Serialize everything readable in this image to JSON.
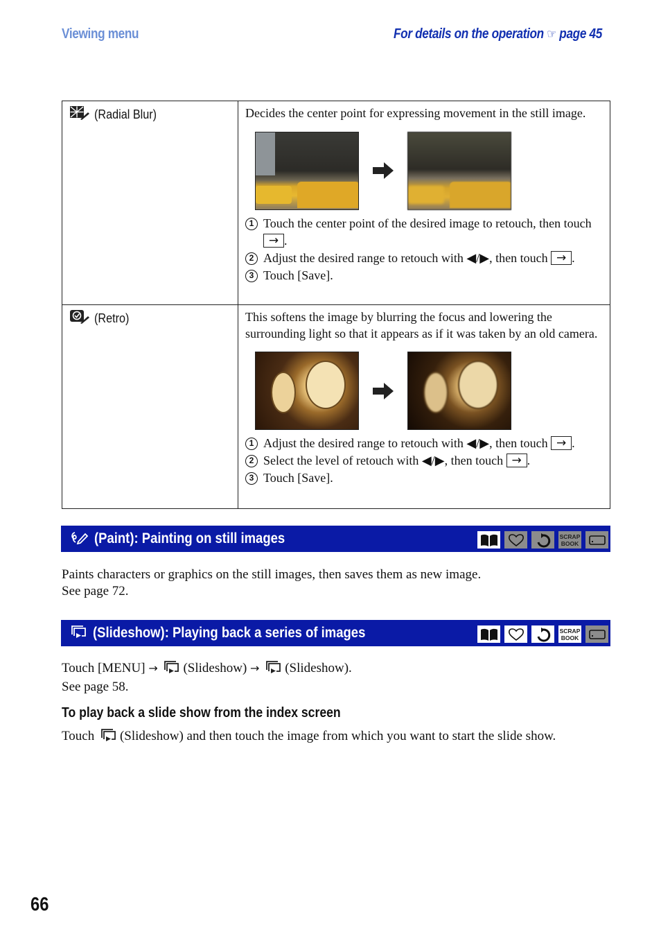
{
  "header": {
    "section": "Viewing menu",
    "ref_prefix": "For details on the operation",
    "ref_icon": "☞",
    "ref_page": "page 45"
  },
  "effects": [
    {
      "icon": "radial-blur-icon",
      "name": "(Radial Blur)",
      "description": "Decides the center point for expressing movement in the still image.",
      "steps": [
        {
          "num": "1",
          "text": "Touch the center point of the desired image to retouch, then touch",
          "suffix": "."
        },
        {
          "num": "2",
          "text": "Adjust the desired range to retouch with ◀/▶, then touch",
          "suffix": "."
        },
        {
          "num": "3",
          "text": "Touch [Save].",
          "suffix": ""
        }
      ]
    },
    {
      "icon": "retro-icon",
      "name": "(Retro)",
      "description": "This softens the image by blurring the focus and lowering the surrounding light so that it appears as if it was taken by an old camera.",
      "steps": [
        {
          "num": "1",
          "text": "Adjust the desired range to retouch with ◀/▶, then touch",
          "suffix": "."
        },
        {
          "num": "2",
          "text": "Select the level of retouch with ◀/▶, then touch",
          "suffix": "."
        },
        {
          "num": "3",
          "text": "Touch [Save].",
          "suffix": ""
        }
      ]
    }
  ],
  "paint": {
    "title": "(Paint): Painting on still images",
    "body_line1": "Paints characters or graphics on the still images, then saves them as new image.",
    "body_line2": "See page 72.",
    "modes": [
      {
        "icon": "book-icon",
        "active": true
      },
      {
        "icon": "heart-icon",
        "active": false
      },
      {
        "icon": "rotate-icon",
        "active": false
      },
      {
        "icon": "scrapbook-icon",
        "label1": "SCRAP",
        "label2": "BOOK",
        "active": false
      },
      {
        "icon": "memory-card-icon",
        "active": false
      }
    ]
  },
  "slideshow": {
    "title": "(Slideshow): Playing back a series of images",
    "body_pre": "Touch [MENU]",
    "body_mid": "(Slideshow)",
    "body_end": "(Slideshow).",
    "body_line2": "See page 58.",
    "modes": [
      {
        "icon": "book-icon",
        "active": true
      },
      {
        "icon": "heart-icon",
        "active": true
      },
      {
        "icon": "rotate-icon",
        "active": true
      },
      {
        "icon": "scrapbook-icon",
        "label1": "SCRAP",
        "label2": "BOOK",
        "active": true
      },
      {
        "icon": "memory-card-icon",
        "active": false
      }
    ],
    "subheading": "To play back a slide show from the index screen",
    "sub_pre": "Touch",
    "sub_post": "(Slideshow) and then touch the image from which you want to start the slide show."
  },
  "page_number": "66"
}
